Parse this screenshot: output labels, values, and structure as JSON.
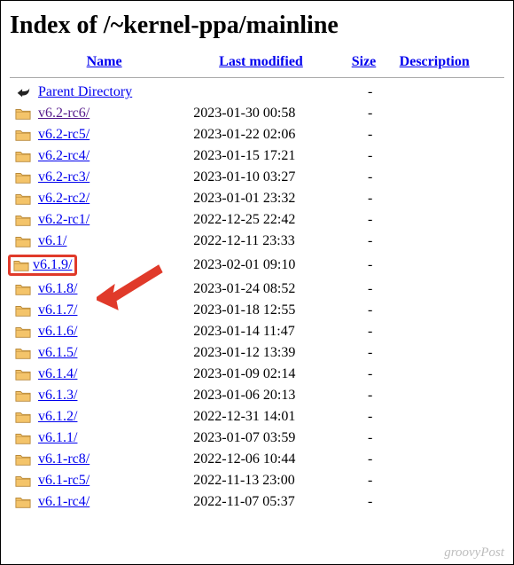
{
  "title": "Index of /~kernel-ppa/mainline",
  "columns": {
    "name": "Name",
    "modified": "Last modified",
    "size": "Size",
    "description": "Description"
  },
  "parent": {
    "label": "Parent Directory",
    "size": "-"
  },
  "highlighted_index": 7,
  "rows": [
    {
      "name": "v6.2-rc6/",
      "modified": "2023-01-30 00:58",
      "size": "-",
      "visited": true
    },
    {
      "name": "v6.2-rc5/",
      "modified": "2023-01-22 02:06",
      "size": "-",
      "visited": false
    },
    {
      "name": "v6.2-rc4/",
      "modified": "2023-01-15 17:21",
      "size": "-",
      "visited": false
    },
    {
      "name": "v6.2-rc3/",
      "modified": "2023-01-10 03:27",
      "size": "-",
      "visited": false
    },
    {
      "name": "v6.2-rc2/",
      "modified": "2023-01-01 23:32",
      "size": "-",
      "visited": false
    },
    {
      "name": "v6.2-rc1/",
      "modified": "2022-12-25 22:42",
      "size": "-",
      "visited": false
    },
    {
      "name": "v6.1/",
      "modified": "2022-12-11 23:33",
      "size": "-",
      "visited": false
    },
    {
      "name": "v6.1.9/",
      "modified": "2023-02-01 09:10",
      "size": "-",
      "visited": false
    },
    {
      "name": "v6.1.8/",
      "modified": "2023-01-24 08:52",
      "size": "-",
      "visited": false
    },
    {
      "name": "v6.1.7/",
      "modified": "2023-01-18 12:55",
      "size": "-",
      "visited": false
    },
    {
      "name": "v6.1.6/",
      "modified": "2023-01-14 11:47",
      "size": "-",
      "visited": false
    },
    {
      "name": "v6.1.5/",
      "modified": "2023-01-12 13:39",
      "size": "-",
      "visited": false
    },
    {
      "name": "v6.1.4/",
      "modified": "2023-01-09 02:14",
      "size": "-",
      "visited": false
    },
    {
      "name": "v6.1.3/",
      "modified": "2023-01-06 20:13",
      "size": "-",
      "visited": false
    },
    {
      "name": "v6.1.2/",
      "modified": "2022-12-31 14:01",
      "size": "-",
      "visited": false
    },
    {
      "name": "v6.1.1/",
      "modified": "2023-01-07 03:59",
      "size": "-",
      "visited": false
    },
    {
      "name": "v6.1-rc8/",
      "modified": "2022-12-06 10:44",
      "size": "-",
      "visited": false
    },
    {
      "name": "v6.1-rc5/",
      "modified": "2022-11-13 23:00",
      "size": "-",
      "visited": false
    },
    {
      "name": "v6.1-rc4/",
      "modified": "2022-11-07 05:37",
      "size": "-",
      "visited": false
    }
  ],
  "watermark": "groovyPost"
}
